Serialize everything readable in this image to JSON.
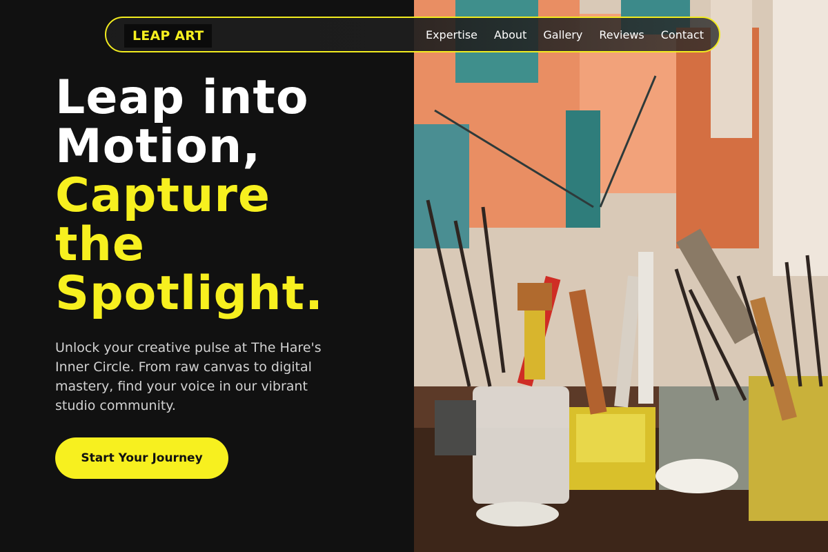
{
  "nav": {
    "logo": "LEAP ART",
    "links": [
      "Expertise",
      "About",
      "Gallery",
      "Reviews",
      "Contact"
    ]
  },
  "hero": {
    "headline_white": [
      "Leap into",
      "Motion,"
    ],
    "headline_yellow": [
      "Capture",
      "the",
      "Spotlight."
    ],
    "subtext": "Unlock your creative pulse at The Hare's Inner Circle. From raw canvas to digital mastery, find your voice in our vibrant studio community.",
    "cta_label": "Start Your Journey"
  },
  "colors": {
    "accent": "#f7f01f",
    "background": "#111111",
    "text": "#ffffff"
  }
}
